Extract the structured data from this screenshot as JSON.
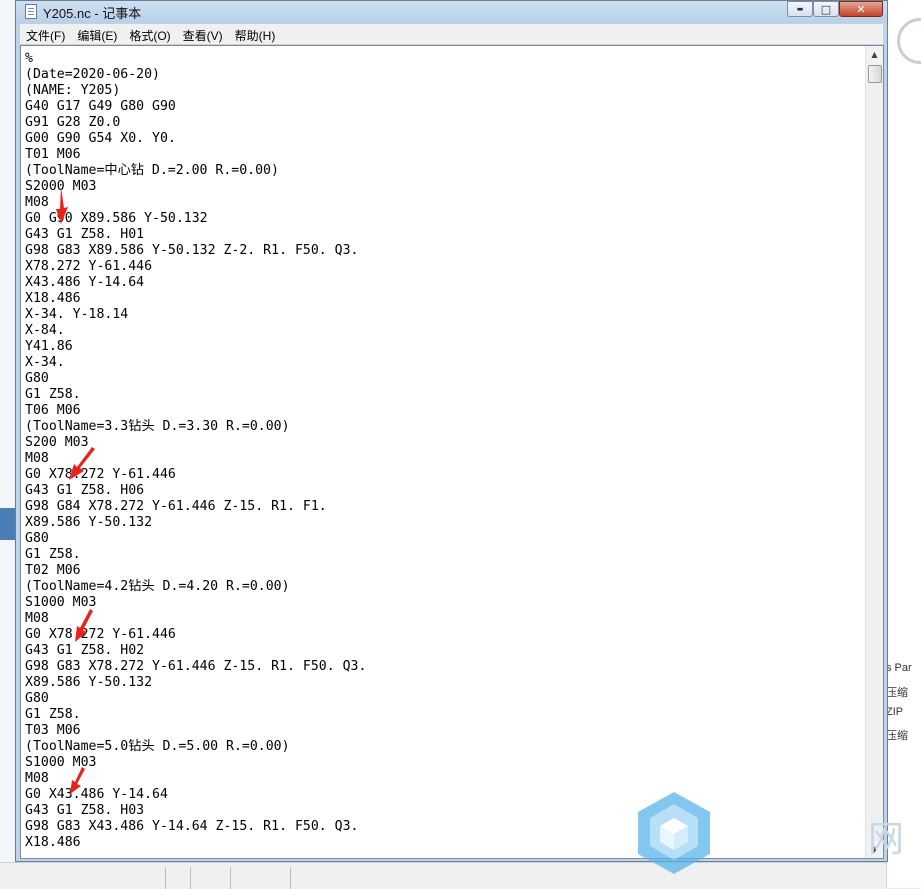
{
  "window": {
    "title": "Y205.nc - 记事本",
    "controls": {
      "minimize": "▬",
      "maximize": "□",
      "close": "✕"
    }
  },
  "menu": [
    {
      "label": "文件(F)"
    },
    {
      "label": "编辑(E)"
    },
    {
      "label": "格式(O)"
    },
    {
      "label": "查看(V)"
    },
    {
      "label": "帮助(H)"
    }
  ],
  "document": {
    "lines": [
      "%",
      "(Date=2020-06-20)",
      "(NAME: Y205)",
      "G40 G17 G49 G80 G90",
      "G91 G28 Z0.0",
      "G00 G90 G54 X0. Y0.",
      "T01 M06",
      "(ToolName=中心钻 D.=2.00 R.=0.00)",
      "S2000 M03",
      "M08",
      "G0 G90 X89.586 Y-50.132",
      "G43 G1 Z58. H01",
      "G98 G83 X89.586 Y-50.132 Z-2. R1. F50. Q3.",
      "X78.272 Y-61.446",
      "X43.486 Y-14.64",
      "X18.486",
      "X-34. Y-18.14",
      "X-84.",
      "Y41.86",
      "X-34.",
      "G80",
      "G1 Z58.",
      "T06 M06",
      "(ToolName=3.3钻头 D.=3.30 R.=0.00)",
      "S200 M03",
      "M08",
      "G0 X78.272 Y-61.446",
      "G43 G1 Z58. H06",
      "G98 G84 X78.272 Y-61.446 Z-15. R1. F1.",
      "X89.586 Y-50.132",
      "G80",
      "G1 Z58.",
      "T02 M06",
      "(ToolName=4.2钻头 D.=4.20 R.=0.00)",
      "S1000 M03",
      "M08",
      "G0 X78.272 Y-61.446",
      "G43 G1 Z58. H02",
      "G98 G83 X78.272 Y-61.446 Z-15. R1. F50. Q3.",
      "X89.586 Y-50.132",
      "G80",
      "G1 Z58.",
      "T03 M06",
      "(ToolName=5.0钻头 D.=5.00 R.=0.00)",
      "S1000 M03",
      "M08",
      "G0 X43.486 Y-14.64",
      "G43 G1 Z58. H03",
      "G98 G83 X43.486 Y-14.64 Z-15. R1. F50. Q3.",
      "X18.486"
    ]
  },
  "background": {
    "side_labels": [
      "s Par",
      "压缩",
      "ZIP",
      "压缩"
    ],
    "watermark_char": "网"
  },
  "colors": {
    "annotation_arrow": "#e8231c",
    "title_bar": "#bcd3ea",
    "close_button": "#c4442d"
  }
}
